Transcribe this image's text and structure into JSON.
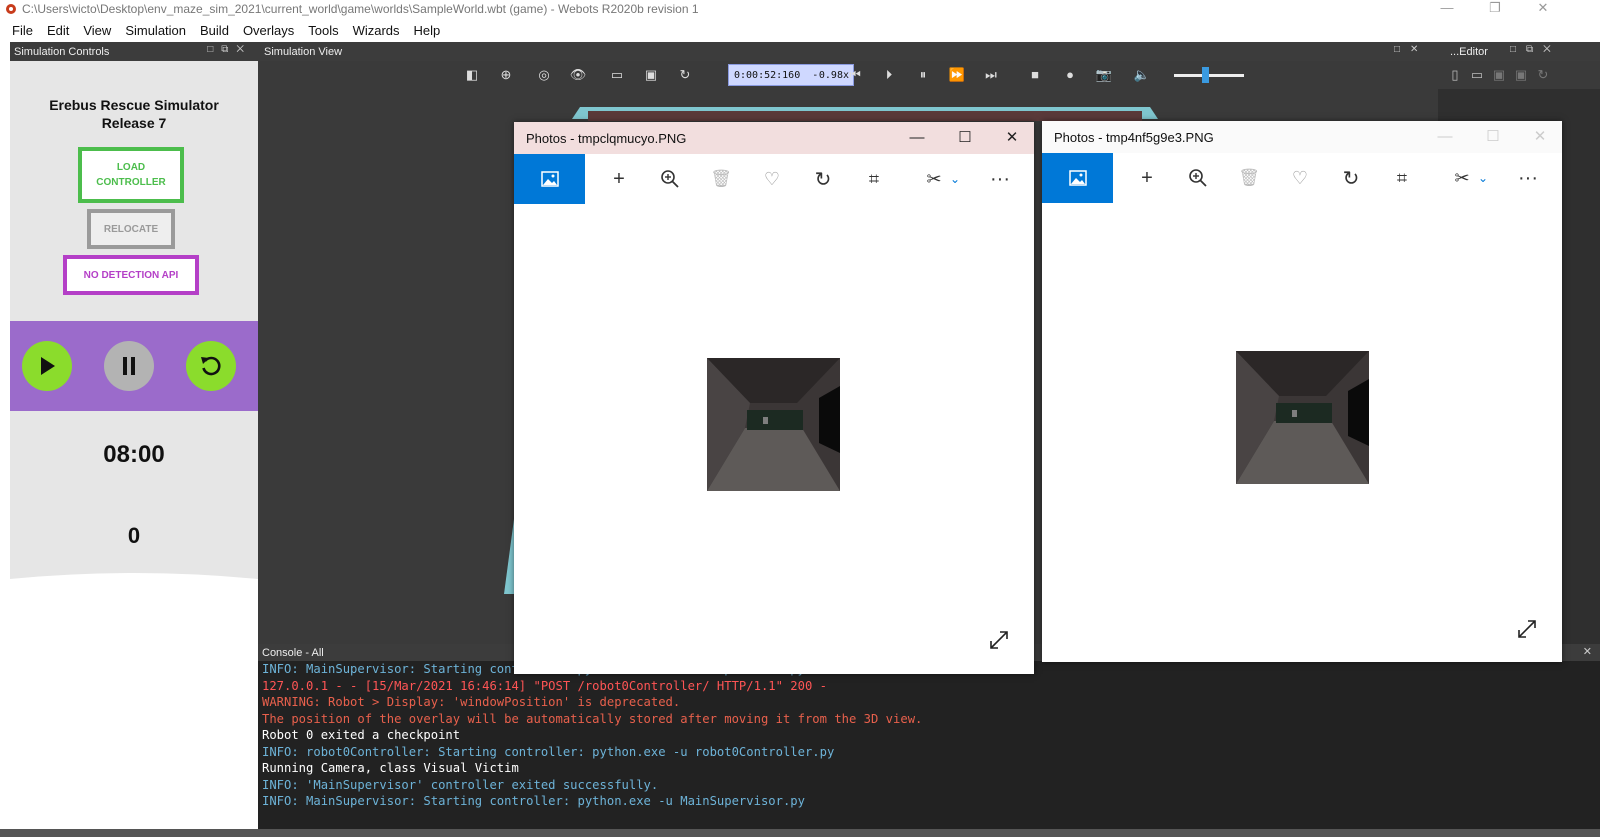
{
  "window": {
    "title": "C:\\Users\\victo\\Desktop\\env_maze_sim_2021\\current_world\\game\\worlds\\SampleWorld.wbt (game) - Webots R2020b revision 1",
    "minimize": "—",
    "restore": "❐",
    "close": "✕"
  },
  "menu": [
    "File",
    "Edit",
    "View",
    "Simulation",
    "Build",
    "Overlays",
    "Tools",
    "Wizards",
    "Help"
  ],
  "left_panel": {
    "header": "Simulation Controls",
    "title_line1": "Erebus Rescue Simulator",
    "title_line2": "Release 7",
    "load_line1": "LOAD",
    "load_line2": "CONTROLLER",
    "relocate": "RELOCATE",
    "no_detection": "NO DETECTION API",
    "timer": "08:00",
    "score": "0"
  },
  "sim_view": {
    "header": "Simulation View",
    "time": "0:00:52:160",
    "separator": "-",
    "speed": "0.98x"
  },
  "editor": {
    "header": "...Editor"
  },
  "console": {
    "header": "Console - All",
    "lines": [
      {
        "text": "INFO: MainSupervisor: Starting controller: python.exe -u MainSupervisor.py",
        "color": "#6db3d8"
      },
      {
        "text": "127.0.0.1 - - [15/Mar/2021 16:46:14] \"POST /robot0Controller/ HTTP/1.1\" 200 -",
        "color": "#ff5555"
      },
      {
        "text": "WARNING: Robot > Display: 'windowPosition' is deprecated.",
        "color": "#e8604c"
      },
      {
        "text": "The position of the overlay will be automatically stored after moving it from the 3D view.",
        "color": "#e8604c"
      },
      {
        "text": "Robot 0 exited a checkpoint",
        "color": "#ffffff"
      },
      {
        "text": "INFO: robot0Controller: Starting controller: python.exe -u robot0Controller.py",
        "color": "#6db3d8"
      },
      {
        "text": "Running Camera, class Visual Victim",
        "color": "#ffffff"
      },
      {
        "text": "INFO: 'MainSupervisor' controller exited successfully.",
        "color": "#6db3d8"
      },
      {
        "text": "INFO: MainSupervisor: Starting controller: python.exe -u MainSupervisor.py",
        "color": "#6db3d8"
      }
    ]
  },
  "photos": {
    "win1_title": "Photos - tmpclqmucyo.PNG",
    "win2_title": "Photos - tmp4nf5g9e3.PNG",
    "more": "···"
  },
  "colors": {
    "accent_blue": "#0078d7",
    "load_green": "#4cbd4c",
    "purple": "#9b6bcb",
    "magenta": "#b43fc7",
    "play_green": "#8bdc2c"
  }
}
